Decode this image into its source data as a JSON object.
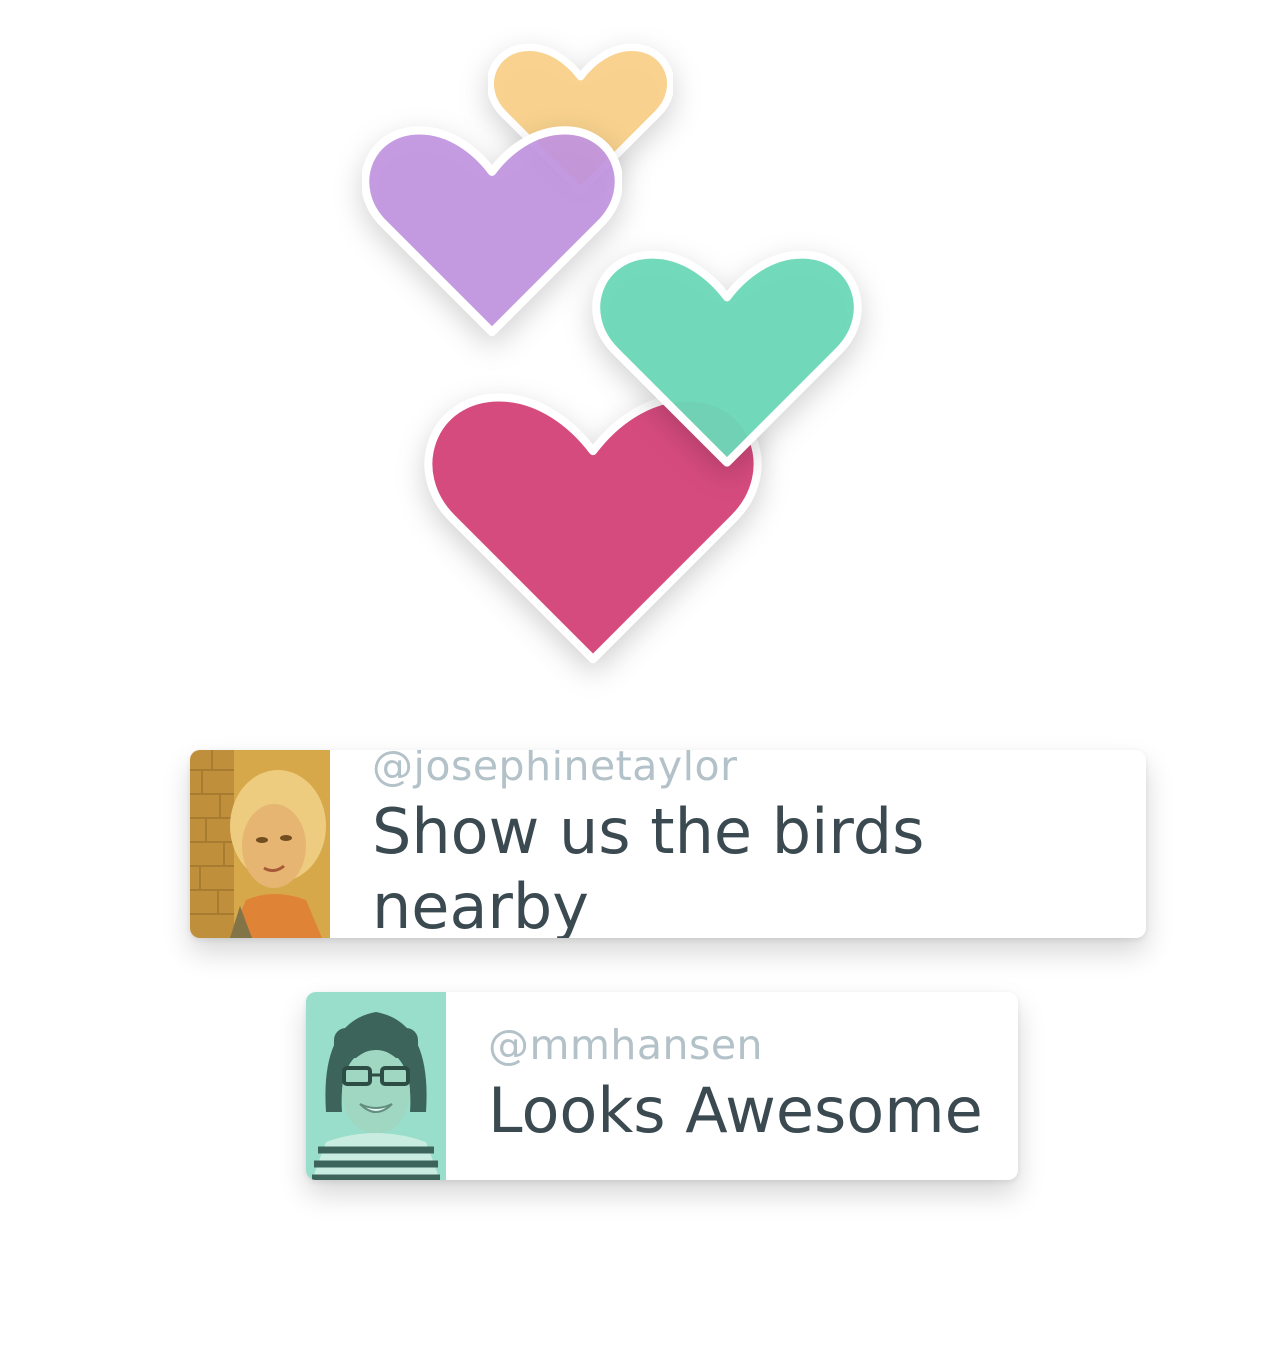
{
  "hearts": [
    {
      "name": "yellow",
      "color": "#f9d189"
    },
    {
      "name": "purple",
      "color": "#c194e0"
    },
    {
      "name": "green",
      "color": "#6cd9b8"
    },
    {
      "name": "pink",
      "color": "#d64b7e"
    }
  ],
  "comments": [
    {
      "username": "@josephinetaylor",
      "message": "Show us the birds nearby",
      "avatar_tint": "#e0a63e"
    },
    {
      "username": "@mmhansen",
      "message": "Looks Awesome",
      "avatar_tint": "#7fd6bd"
    }
  ]
}
